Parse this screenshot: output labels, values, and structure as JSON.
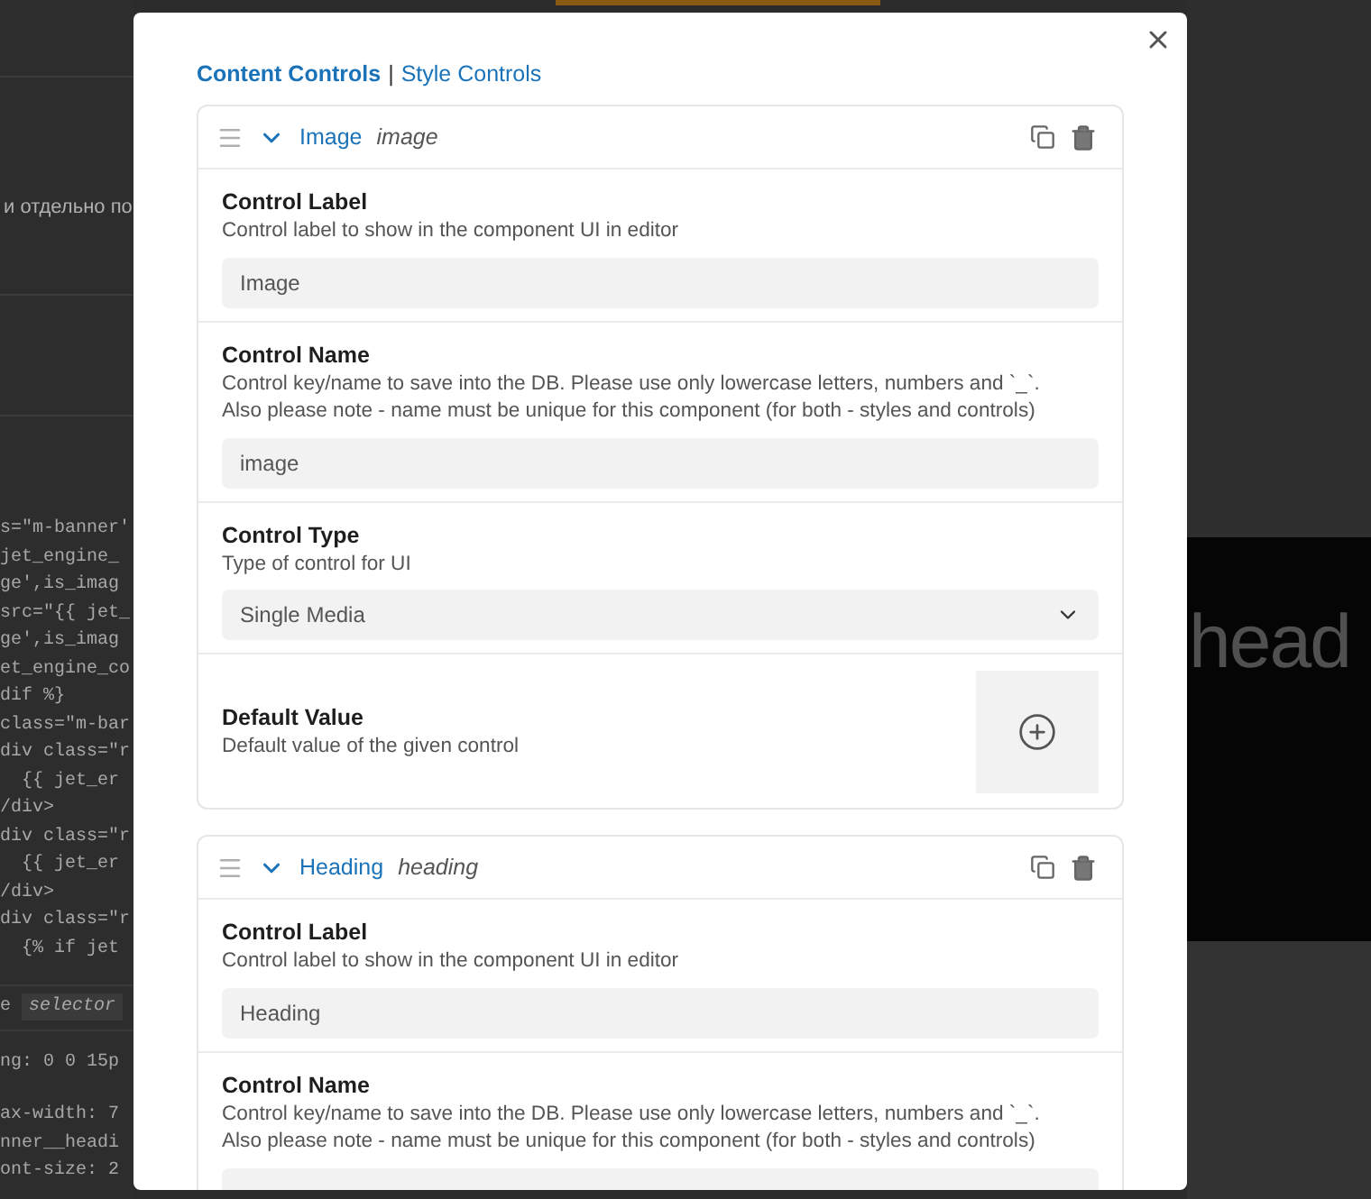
{
  "background": {
    "notice": "и отдельно по",
    "code_lines": [
      "s=\"m-banner'",
      "jet_engine_",
      "ge',is_imag",
      "src=\"{{ jet_",
      "ge',is_imag",
      "et_engine_co",
      "dif %}",
      "class=\"m-bar",
      "div class=\"r",
      "  {{ jet_er",
      "/div>",
      "div class=\"r",
      "  {{ jet_er",
      "/div>",
      "div class=\"r",
      "  {% if jet"
    ],
    "selector_line": {
      "prefix": "e",
      "word": "selector"
    },
    "css_lines": [
      "ng: 0 0 15p",
      "ax-width: 7",
      "nner__headi",
      "ont-size: 2"
    ],
    "preview_heading": "head"
  },
  "dialog": {
    "tabs": [
      {
        "label": "Content Controls",
        "selected": true
      },
      {
        "label": "Style Controls",
        "selected": false
      }
    ],
    "separator": "|",
    "controls": [
      {
        "title": "Image",
        "name": "image",
        "expanded": true,
        "fields": [
          {
            "kind": "text",
            "label": "Control Label",
            "description": [
              "Control label to show in the component UI in editor"
            ],
            "value": "Image"
          },
          {
            "kind": "text",
            "label": "Control Name",
            "description": [
              "Control key/name to save into the DB. Please use only lowercase letters, numbers and `_`.",
              "Also please note - name must be unique for this component (for both - styles and controls)"
            ],
            "value": "image"
          },
          {
            "kind": "select",
            "label": "Control Type",
            "description": [
              "Type of control for UI"
            ],
            "value": "Single Media"
          },
          {
            "kind": "media",
            "label": "Default Value",
            "description": [
              "Default value of the given control"
            ]
          }
        ]
      },
      {
        "title": "Heading",
        "name": "heading",
        "expanded": true,
        "fields": [
          {
            "kind": "text",
            "label": "Control Label",
            "description": [
              "Control label to show in the component UI in editor"
            ],
            "value": "Heading"
          },
          {
            "kind": "text",
            "label": "Control Name",
            "description": [
              "Control key/name to save into the DB. Please use only lowercase letters, numbers and `_`.",
              "Also please note - name must be unique for this component (for both - styles and controls)"
            ]
          }
        ]
      }
    ]
  }
}
